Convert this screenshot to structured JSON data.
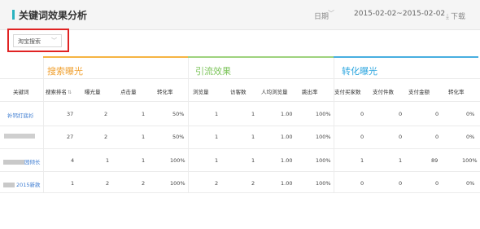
{
  "header": {
    "title": "关键词效果分析",
    "date_label": "日期",
    "date_range": "2015-02-02~2015-02-02",
    "download_label": "下载"
  },
  "filter": {
    "selected": "淘宝搜索"
  },
  "groups": [
    {
      "label": "搜索曝光",
      "color": "#f0a030"
    },
    {
      "label": "引流效果",
      "color": "#7cc45a"
    },
    {
      "label": "转化曝光",
      "color": "#2da6df"
    }
  ],
  "columns": [
    "关键词",
    "搜索排名",
    "曝光量",
    "点击量",
    "转化率",
    "浏览量",
    "访客数",
    "人均浏览量",
    "跳出率",
    "支付买家数",
    "支付件数",
    "支付金额",
    "转化率"
  ],
  "rows": [
    {
      "keyword": "补钙打底衫",
      "values": [
        "37",
        "2",
        "1",
        "50%",
        "1",
        "1",
        "1.00",
        "100%",
        "0",
        "0",
        "0",
        "0%"
      ]
    },
    {
      "keyword": "",
      "values": [
        "27",
        "2",
        "1",
        "50%",
        "1",
        "1",
        "1.00",
        "100%",
        "0",
        "0",
        "0",
        "0%"
      ]
    },
    {
      "keyword": "园倾长",
      "values": [
        "4",
        "1",
        "1",
        "100%",
        "1",
        "1",
        "1.00",
        "100%",
        "1",
        "1",
        "89",
        "100%"
      ]
    },
    {
      "keyword": "2015新款",
      "values": [
        "1",
        "2",
        "2",
        "100%",
        "2",
        "2",
        "1.00",
        "100%",
        "0",
        "0",
        "0",
        "0%"
      ]
    }
  ]
}
